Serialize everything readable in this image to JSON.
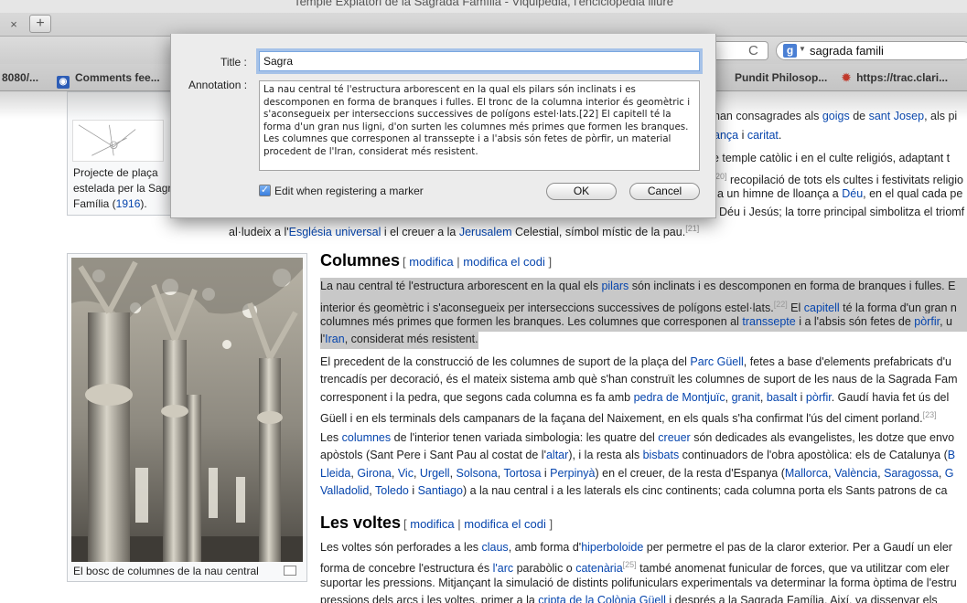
{
  "window": {
    "title": "Temple Expiatori de la Sagrada Família - Viquipèdia, l'enciclopèdia lliure"
  },
  "tabs": {
    "close": "×",
    "new_tab": "+"
  },
  "toolbar": {
    "reload": "C",
    "search_engine": "g",
    "search_value": "sagrada famili"
  },
  "bookmarks": [
    {
      "label": "8080/..."
    },
    {
      "label": "Comments fee..."
    },
    {
      "label": "Pundit Philosop..."
    },
    {
      "label": "https://trac.clari..."
    }
  ],
  "article": {
    "top_lines": [
      {
        "pre": "han consagrades als ",
        "l1": "goigs",
        "mid": " de ",
        "l2": "sant Josep",
        "post": ", als pi"
      },
      {
        "pre": "",
        "l1": "",
        "mid": "",
        "l2": "ança",
        "post": " i ",
        "l3": "caritat",
        "end": "."
      },
      {
        "pre": "de temple catòlic i en el culte religiós, adaptant t"
      },
      {
        "sup": "20]",
        "pre": " recopilació de tots els cultes i festivitats religio"
      },
      {
        "pre": "a un himne de lloança a ",
        "l1": "Déu",
        "post": ", en el qual cada pe"
      },
      {
        "pre": "Déu i Jesús; la torre principal simbolitza el triomf"
      }
    ],
    "line_jerusalem": {
      "pre": "al·ludeix a l'",
      "l1": "Església universal",
      "mid": " i el creuer a la ",
      "l2": "Jerusalem",
      "post": " Celestial, símbol místic de la pau.",
      "sup": "[21]"
    },
    "thumb1": {
      "caption": [
        "Projecte de plaça",
        "estelada per la Sagra",
        "Família (1916)."
      ],
      "year": "1916"
    },
    "thumb2": {
      "caption": "El bosc de columnes de la nau central"
    },
    "columnes": {
      "heading": "Columnes",
      "edit": "modifica",
      "edit_code": "modifica el codi",
      "p1": [
        {
          "pre": "La nau central té l'estructura arborescent en la qual els ",
          "l1": "pilars",
          "post": " són inclinats i es descomponen en forma de branques i fulles. E"
        },
        {
          "pre": "interior és geomètric i s'aconsegueix per interseccions successives de polígons estel·lats.",
          "sup": "[22]",
          "mid": " El ",
          "l1": "capitell",
          "post": " té la forma d'un gran n"
        },
        {
          "pre": "columnes més primes que formen les branques. Les columnes que corresponen al ",
          "l1": "transsepte",
          "mid": " i a l'absis són fetes de ",
          "l2": "pòrfir",
          "post": ", u"
        },
        {
          "pre": "l'",
          "l1": "Iran",
          "post": ", considerat més resistent."
        }
      ],
      "p2": [
        {
          "pre": "El precedent de la construcció de les columnes de suport de la plaça del ",
          "l1": "Parc Güell",
          "post": ", fetes a base d'elements prefabricats d'u"
        },
        {
          "pre": "trencadís per decoració, és el mateix sistema amb què s'han construït les columnes de suport de les naus de la Sagrada Fam"
        },
        {
          "pre": "corresponent i la pedra, que segons cada columna es fa amb ",
          "l1": "pedra de Montjuïc",
          "mid": ", ",
          "l2": "granit",
          "mid2": ", ",
          "l3": "basalt",
          "mid3": " i ",
          "l4": "pòrfir",
          "post": ". Gaudí havia fet ús del"
        },
        {
          "pre": "Güell i en els terminals dels campanars de la façana del Naixement, en els quals s'ha confirmat l'ús del ciment porland.",
          "sup": "[23]"
        }
      ],
      "p3": [
        {
          "pre": "Les ",
          "l1": "columnes",
          "mid": " de l'interior tenen variada simbologia: les quatre del ",
          "l2": "creuer",
          "post": " són dedicades als evangelistes, les dotze que envo"
        },
        {
          "pre": "apòstols (Sant Pere i Sant Pau al costat de l'",
          "l1": "altar",
          "mid": "), i la resta als ",
          "l2": "bisbats",
          "post": " continuadors de l'obra apostòlica: els de Catalunya (",
          "l3": "B"
        },
        {
          "l1": "Lleida",
          "a": ", ",
          "l2": "Girona",
          "b": ", ",
          "l3": "Vic",
          "c": ", ",
          "l4": "Urgell",
          "d": ", ",
          "l5": "Solsona",
          "e": ", ",
          "l6": "Tortosa",
          "f": " i ",
          "l7": "Perpinyà",
          "g": ") en el creuer, de la resta d'Espanya (",
          "l8": "Mallorca",
          "h": ", ",
          "l9": "València",
          "i": ", ",
          "l10": "Saragossa",
          "j": ", ",
          "l11": "G"
        },
        {
          "l1": "Valladolid",
          "a": ", ",
          "l2": "Toledo",
          "b": " i ",
          "l3": "Santiago",
          "post": ") a la nau central i a les laterals els cinc continents; cada columna porta els Sants patrons de ca"
        }
      ]
    },
    "voltes": {
      "heading": "Les voltes",
      "edit": "modifica",
      "edit_code": "modifica el codi",
      "p1": [
        {
          "pre": "Les voltes són perforades a les ",
          "l1": "claus",
          "mid": ", amb forma d'",
          "l2": "hiperboloide",
          "post": " per permetre el pas de la claror exterior. Per a Gaudí un eler"
        },
        {
          "pre": "forma de concebre l'estructura és ",
          "l1": "l'arc",
          "mid": " parabòlic o ",
          "l2": "catenària",
          "sup": "[25]",
          "post": " també anomenat funicular de forces, que va utilitzar com eler"
        },
        {
          "pre": "suportar les pressions. Mitjançant la simulació de distints polifuniculars experimentals va determinar la forma òptima de l'estru"
        },
        {
          "pre": "pressions dels arcs i les voltes, primer a la ",
          "l1": "cripta de la Colònia Güell",
          "post": " i després a la Sagrada Família. Així, va dissenyar els"
        }
      ]
    }
  },
  "dialog": {
    "title_label": "Title :",
    "title_value": "Sagra",
    "annotation_label": "Annotation :",
    "annotation_text": "La nau central té l'estructura arborescent en la qual els pilars són inclinats i es descomponen en forma de branques i fulles. El tronc de la columna interior és geomètric i s'aconsegueix per interseccions successives de polígons estel·lats.[22] El capitell té la forma d'un gran nus ligni, d'on surten les columnes més primes que formen les branques. Les columnes que corresponen al transsepte i a l'absis són fetes de pòrfir, un material procedent de l'Iran, considerat més resistent.",
    "checkbox_label": "Edit when registering a marker",
    "checkbox_checked": true,
    "ok": "OK",
    "cancel": "Cancel"
  }
}
